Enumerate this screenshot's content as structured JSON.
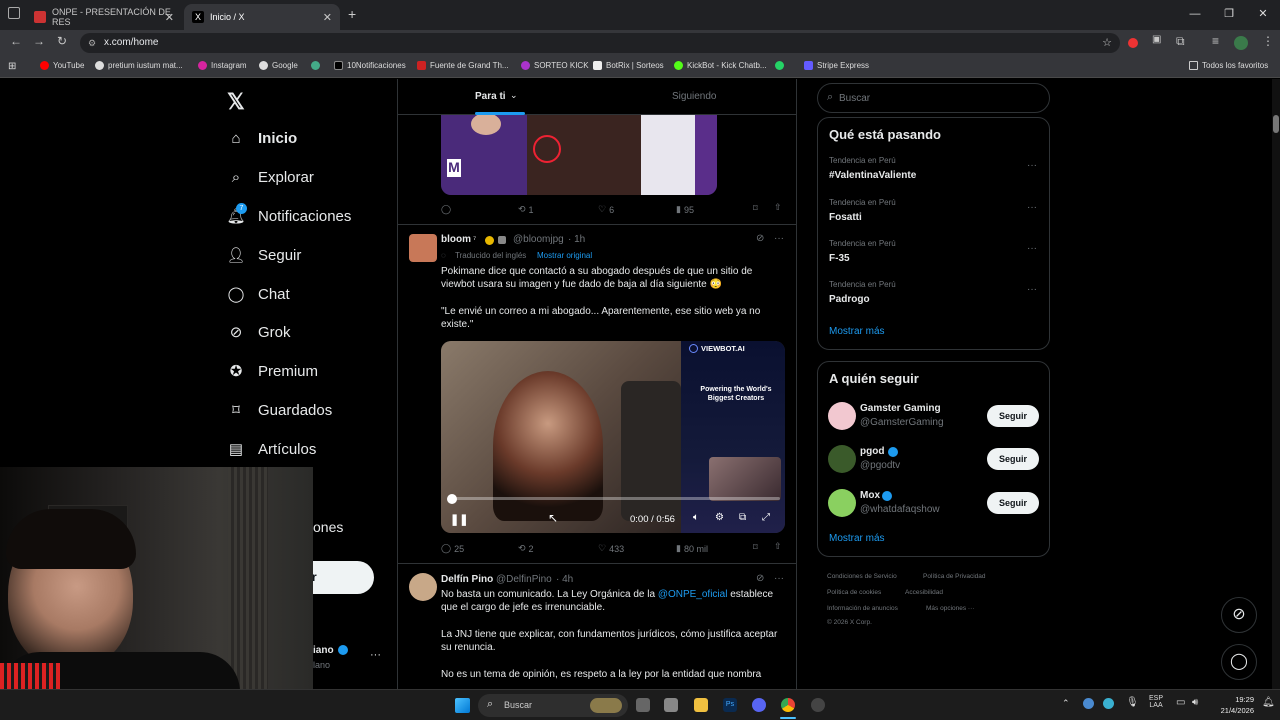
{
  "browser": {
    "tabs": [
      {
        "title": "ONPE - PRESENTACIÓN DE RES"
      },
      {
        "title": "Inicio / X"
      }
    ],
    "url": "x.com/home",
    "bookmarks": [
      "YouTube",
      "pretium iustum mat...",
      "Instagram",
      "Google",
      "10Notificaciones",
      "Fuente de Grand Th...",
      "SORTEO KICK",
      "BotRix | Sorteos",
      "KickBot - Kick Chatb...",
      "Stripe Express"
    ],
    "all_bookmarks": "Todos los favoritos"
  },
  "sidebar": {
    "items": [
      {
        "label": "Inicio",
        "icon": "home-icon"
      },
      {
        "label": "Explorar",
        "icon": "search-icon"
      },
      {
        "label": "Notificaciones",
        "icon": "bell-icon",
        "badge": "7"
      },
      {
        "label": "Seguir",
        "icon": "person-plus-icon"
      },
      {
        "label": "Chat",
        "icon": "chat-icon"
      },
      {
        "label": "Grok",
        "icon": "grok-icon"
      },
      {
        "label": "Premium",
        "icon": "verified-icon"
      },
      {
        "label": "Guardados",
        "icon": "bookmark-icon"
      },
      {
        "label": "Artículos",
        "icon": "articles-icon"
      }
    ],
    "partial_item": "ones",
    "post_button": "r",
    "account_partial_name": "iano",
    "account_partial_handle": "lano"
  },
  "feed": {
    "tabs": [
      "Para ti",
      "Siguiendo"
    ],
    "first_tweet_actions": {
      "replies": "",
      "retweets": "1",
      "likes": "6",
      "views": "95"
    },
    "tweet2": {
      "name": "bloom",
      "handle": "@bloomjpg",
      "time": "· 1h",
      "translated": "Traducido del inglés",
      "show_original": "Mostrar original",
      "text1": "Pokimane dice que contactó a su abogado después de que un sitio de viewbot usara su imagen y fue dado de baja al día siguiente 😳",
      "text2": "\"Le envié un correo a mi abogado... Aparentemente, ese sitio web ya no existe.\"",
      "video_time": "0:00 / 0:56",
      "video_brand": "VIEWBOT.AI",
      "video_headline": "Powering the World's Biggest Creators",
      "actions": {
        "replies": "25",
        "retweets": "2",
        "likes": "433",
        "views": "80 mil"
      }
    },
    "tweet3": {
      "name": "Delfín Pino",
      "handle": "@DelfinPino",
      "time": "· 4h",
      "text1_a": "No basta un comunicado. La Ley Orgánica de la ",
      "text1_mention": "@ONPE_oficial",
      "text1_b": " establece que el cargo de jefe es irrenunciable.",
      "text2": "La JNJ tiene que explicar, con fundamentos jurídicos, cómo justifica aceptar su renuncia.",
      "text3": "No es un tema de opinión, es respeto a la ley por la entidad que nombra"
    }
  },
  "right": {
    "search_placeholder": "Buscar",
    "trends_title": "Qué está pasando",
    "trends": [
      {
        "category": "Tendencia en Perú",
        "name": "#ValentinaValiente"
      },
      {
        "category": "Tendencia en Perú",
        "name": "Fosatti"
      },
      {
        "category": "Tendencia en Perú",
        "name": "F-35"
      },
      {
        "category": "Tendencia en Perú",
        "name": "Padrogo"
      }
    ],
    "show_more": "Mostrar más",
    "follow_title": "A quién seguir",
    "follow": [
      {
        "name": "Gamster Gaming",
        "handle": "@GamsterGaming",
        "button": "Seguir"
      },
      {
        "name": "pgod",
        "handle": "@pgodtv",
        "button": "Seguir"
      },
      {
        "name": "Mox",
        "handle": "@whatdafaqshow",
        "button": "Seguir"
      }
    ],
    "footer": [
      "Condiciones de Servicio",
      "Política de Privacidad",
      "Política de cookies",
      "Accesibilidad",
      "Información de anuncios",
      "Más opciones ···",
      "© 2026 X Corp."
    ]
  },
  "taskbar": {
    "search": "Buscar",
    "lang": "ESP",
    "lang2": "LAA",
    "time": "19:29",
    "date": "21/4/2026"
  },
  "colors": {
    "accent": "#1d9bf0",
    "bg": "#000000",
    "border": "#2f3336"
  }
}
